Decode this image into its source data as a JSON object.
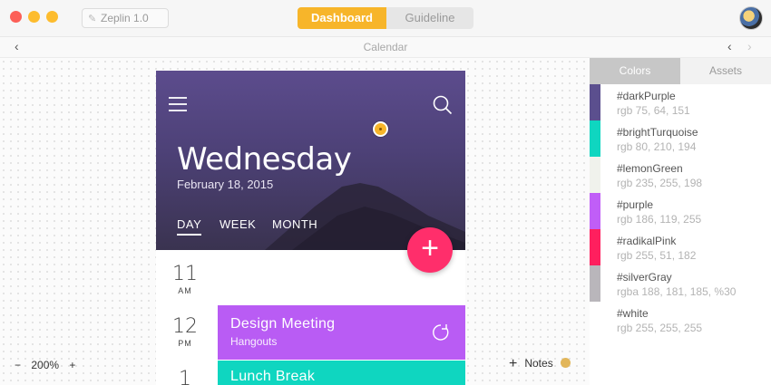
{
  "window": {
    "app_title": "Zeplin 1.0",
    "tabs": [
      "Dashboard",
      "Guideline"
    ],
    "active_tab": "Dashboard"
  },
  "nav": {
    "screen_name": "Calendar",
    "back_glyph": "‹",
    "prev_glyph": "‹",
    "next_glyph": "›"
  },
  "calendar": {
    "day_name": "Wednesday",
    "date": "February 18, 2015",
    "view_tabs": [
      "DAY",
      "WEEK",
      "MONTH"
    ],
    "active_view": "DAY",
    "fab_label": "+",
    "hours": [
      {
        "num": "11",
        "ampm": "AM"
      },
      {
        "num": "12",
        "ampm": "PM"
      },
      {
        "num": "1",
        "ampm": ""
      }
    ],
    "events": [
      {
        "title": "Design Meeting",
        "subtitle": "Hangouts",
        "color": "#b95cf4"
      },
      {
        "title": "Lunch Break",
        "subtitle": "",
        "color": "#0fd6c0"
      }
    ]
  },
  "footer": {
    "zoom_minus": "−",
    "zoom_level": "200%",
    "zoom_plus": "+",
    "notes_plus": "+",
    "notes_label": "Notes"
  },
  "panel": {
    "tabs": [
      "Colors",
      "Assets"
    ],
    "active_tab": "Colors",
    "colors": [
      {
        "name": "#darkPurple",
        "value": "rgb 75, 64, 151",
        "hex": "#5b4f8e"
      },
      {
        "name": "#brightTurquoise",
        "value": "rgb 80, 210, 194",
        "hex": "#0fd6c0"
      },
      {
        "name": "#lemonGreen",
        "value": "rgb 235, 255, 198",
        "hex": "#f0f2ec"
      },
      {
        "name": "#purple",
        "value": "rgb 186, 119, 255",
        "hex": "#c05ef7"
      },
      {
        "name": "#radikalPink",
        "value": "rgb 255, 51, 182",
        "hex": "#ff1f5e"
      },
      {
        "name": "#silverGray",
        "value": "rgba 188, 181, 185, %30",
        "hex": "#b9b6bb"
      },
      {
        "name": "#white",
        "value": "rgb 255, 255, 255",
        "hex": "#ffffff"
      }
    ]
  }
}
